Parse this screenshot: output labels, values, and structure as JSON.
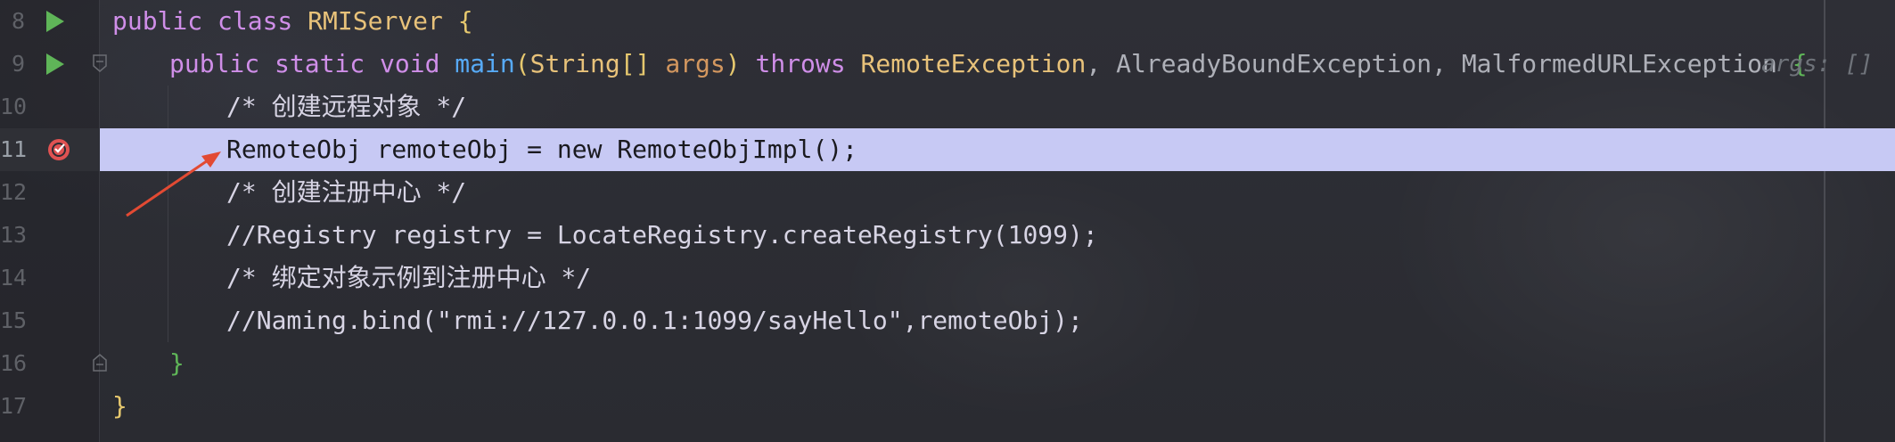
{
  "editor": {
    "lines": [
      {
        "number": "8",
        "tokens": {
          "t1": "public class ",
          "t2": "RMIServer",
          "t3": " {"
        }
      },
      {
        "number": "9",
        "tokens": {
          "t1": "public static void ",
          "t2": "main",
          "t3": "(",
          "t4": "String",
          "t5": "[] ",
          "t6": "args",
          "t7": ") ",
          "t8": "throws ",
          "t9": "RemoteException",
          "t10": ", ",
          "t11": "AlreadyBoundException",
          "t12": ", ",
          "t13": "MalformedURLException",
          "t14": " {",
          "hint": "args: []"
        }
      },
      {
        "number": "10",
        "text": "/* 创建远程对象 */"
      },
      {
        "number": "11",
        "text": "RemoteObj remoteObj = new RemoteObjImpl();"
      },
      {
        "number": "12",
        "text": "/* 创建注册中心 */"
      },
      {
        "number": "13",
        "text": "//Registry registry = LocateRegistry.createRegistry(1099);"
      },
      {
        "number": "14",
        "text": "/* 绑定对象示例到注册中心 */"
      },
      {
        "number": "15",
        "text": "//Naming.bind(\"rmi://127.0.0.1:1099/sayHello\",remoteObj);"
      },
      {
        "number": "16",
        "text": "}"
      },
      {
        "number": "17",
        "text": "}"
      }
    ]
  },
  "colors": {
    "current_line_highlight": "#c7c9f4",
    "breakpoint": "#e05252",
    "run_icon": "#5fb558",
    "arrow": "#e24a33"
  },
  "icons": {
    "run": "run-gutter-icon",
    "fold": "fold-marker-icon",
    "breakpoint": "breakpoint-icon",
    "arrow": "annotation-arrow"
  }
}
